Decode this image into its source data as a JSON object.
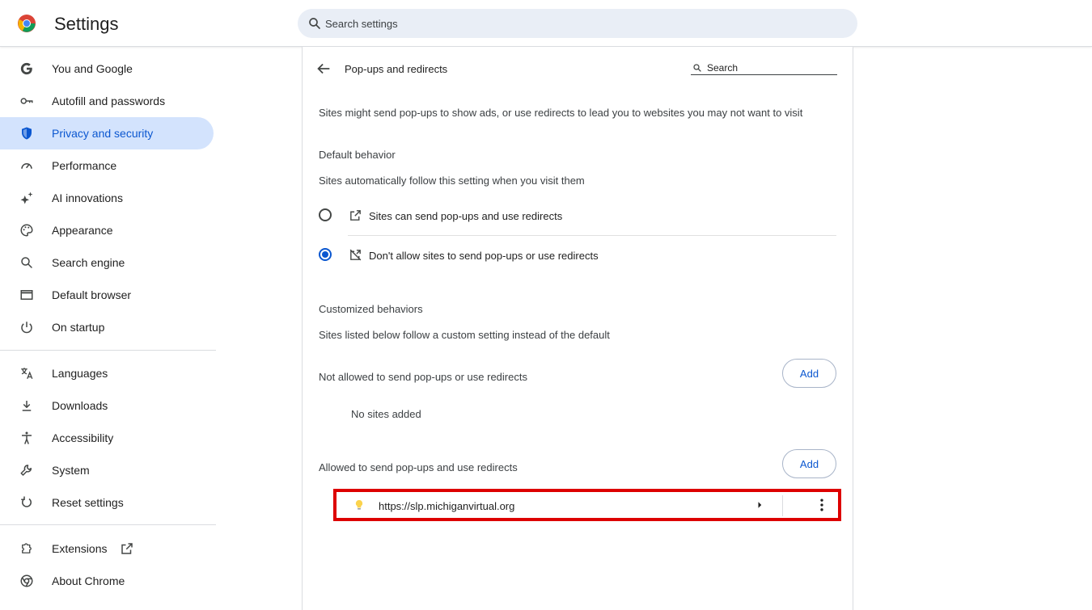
{
  "header": {
    "title": "Settings",
    "search_placeholder": "Search settings",
    "logo_icon": "chrome-logo-icon"
  },
  "sidebar": {
    "items": [
      {
        "label": "You and Google",
        "icon": "google-g-icon"
      },
      {
        "label": "Autofill and passwords",
        "icon": "key-icon"
      },
      {
        "label": "Privacy and security",
        "icon": "shield-icon",
        "active": true
      },
      {
        "label": "Performance",
        "icon": "speedometer-icon"
      },
      {
        "label": "AI innovations",
        "icon": "sparkle-icon"
      },
      {
        "label": "Appearance",
        "icon": "palette-icon"
      },
      {
        "label": "Search engine",
        "icon": "search-icon"
      },
      {
        "label": "Default browser",
        "icon": "browser-window-icon"
      },
      {
        "label": "On startup",
        "icon": "power-icon"
      },
      {
        "label": "Languages",
        "icon": "translate-icon"
      },
      {
        "label": "Downloads",
        "icon": "download-icon"
      },
      {
        "label": "Accessibility",
        "icon": "accessibility-icon"
      },
      {
        "label": "System",
        "icon": "wrench-icon"
      },
      {
        "label": "Reset settings",
        "icon": "reset-icon"
      },
      {
        "label": "Extensions",
        "icon": "puzzle-icon"
      },
      {
        "label": "About Chrome",
        "icon": "chrome-outline-icon"
      }
    ]
  },
  "main": {
    "title": "Pop-ups and redirects",
    "search_placeholder": "Search",
    "description": "Sites might send pop-ups to show ads, or use redirects to lead you to websites you may not want to visit",
    "default_behavior": {
      "heading": "Default behavior",
      "subtext": "Sites automatically follow this setting when you visit them",
      "options": [
        {
          "label": "Sites can send pop-ups and use redirects",
          "checked": false,
          "icon": "open-in-new-icon"
        },
        {
          "label": "Don't allow sites to send pop-ups or use redirects",
          "checked": true,
          "icon": "blocked-popup-icon"
        }
      ]
    },
    "customized": {
      "heading": "Customized behaviors",
      "subtext": "Sites listed below follow a custom setting instead of the default",
      "not_allowed": {
        "label": "Not allowed to send pop-ups or use redirects",
        "add_label": "Add",
        "empty": "No sites added"
      },
      "allowed": {
        "label": "Allowed to send pop-ups and use redirects",
        "add_label": "Add",
        "sites": [
          {
            "url": "https://slp.michiganvirtual.org",
            "icon": "lightbulb-icon"
          }
        ]
      }
    }
  },
  "colors": {
    "accent": "#0b57d0",
    "active_bg": "#d3e3fd",
    "highlight_border": "#dd0000"
  }
}
